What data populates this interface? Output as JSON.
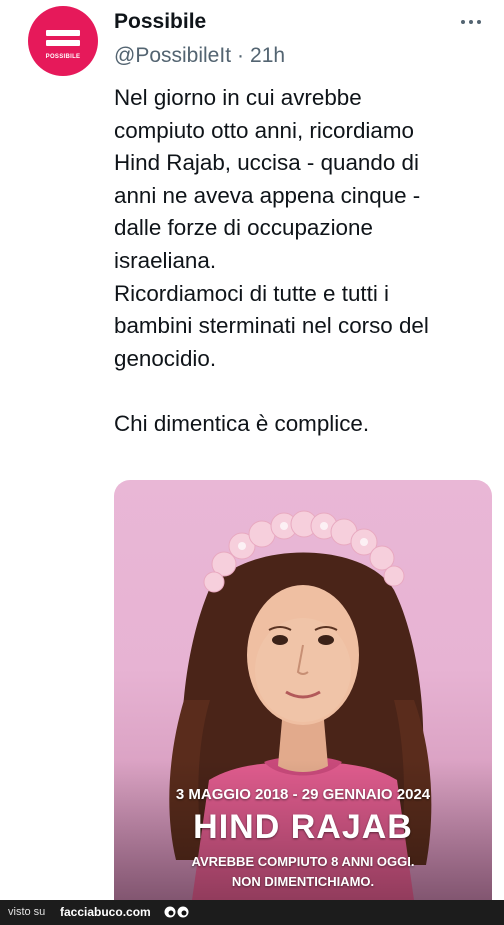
{
  "account": {
    "name": "Possibile",
    "handle": "@PossibileIt",
    "separator": "·",
    "time": "21h",
    "avatar_text": "POSSIBILE",
    "brand_color": "#e6195a"
  },
  "tweet": {
    "text": "Nel giorno in cui avrebbe\ncompiuto otto anni, ricordiamo\nHind Rajab, uccisa - quando di\nanni ne aveva appena cinque -\ndalle forze di occupazione\nisraeliana.\nRicordiamoci di tutte e tutti i\nbambini sterminati nel corso del\ngenocidio.\n\nChi dimentica è complice."
  },
  "media": {
    "dates": "3 MAGGIO 2018 - 29 GENNAIO 2024",
    "title": "HIND RAJAB",
    "line1": "AVREBBE COMPIUTO 8 ANNI OGGI.",
    "line2": "NON DIMENTICHIAMO."
  },
  "footer": {
    "visto_su": "visto su",
    "site": "facciabuco.com"
  },
  "icons": {
    "more": "more-options-icon",
    "eyes": "eyes-icon"
  }
}
